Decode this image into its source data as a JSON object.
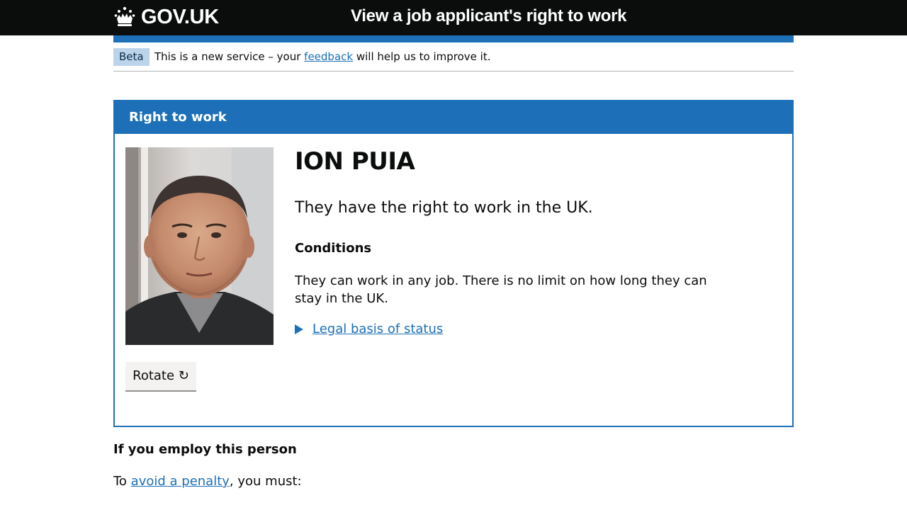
{
  "header": {
    "logo_text": "GOV.UK",
    "service_name": "View a job applicant's right to work"
  },
  "phase_banner": {
    "tag": "Beta",
    "text_before": "This is a new service – your ",
    "link_text": "feedback",
    "text_after": " will help us to improve it."
  },
  "panel": {
    "title": "Right to work",
    "name": "ION PUIA",
    "status": "They have the right to work in the UK.",
    "conditions_heading": "Conditions",
    "conditions_text": "They can work in any job. There is no limit on how long they can stay in the UK.",
    "legal_link": "Legal basis of status",
    "rotate_button": "Rotate ↻"
  },
  "employ": {
    "heading": "If you employ this person",
    "text_before": "To ",
    "link_text": "avoid a penalty",
    "text_after": ", you must:"
  },
  "colors": {
    "header_bg": "#0b0c0c",
    "brand_blue": "#1d70b8",
    "tag_bg": "#bbd4ea"
  }
}
